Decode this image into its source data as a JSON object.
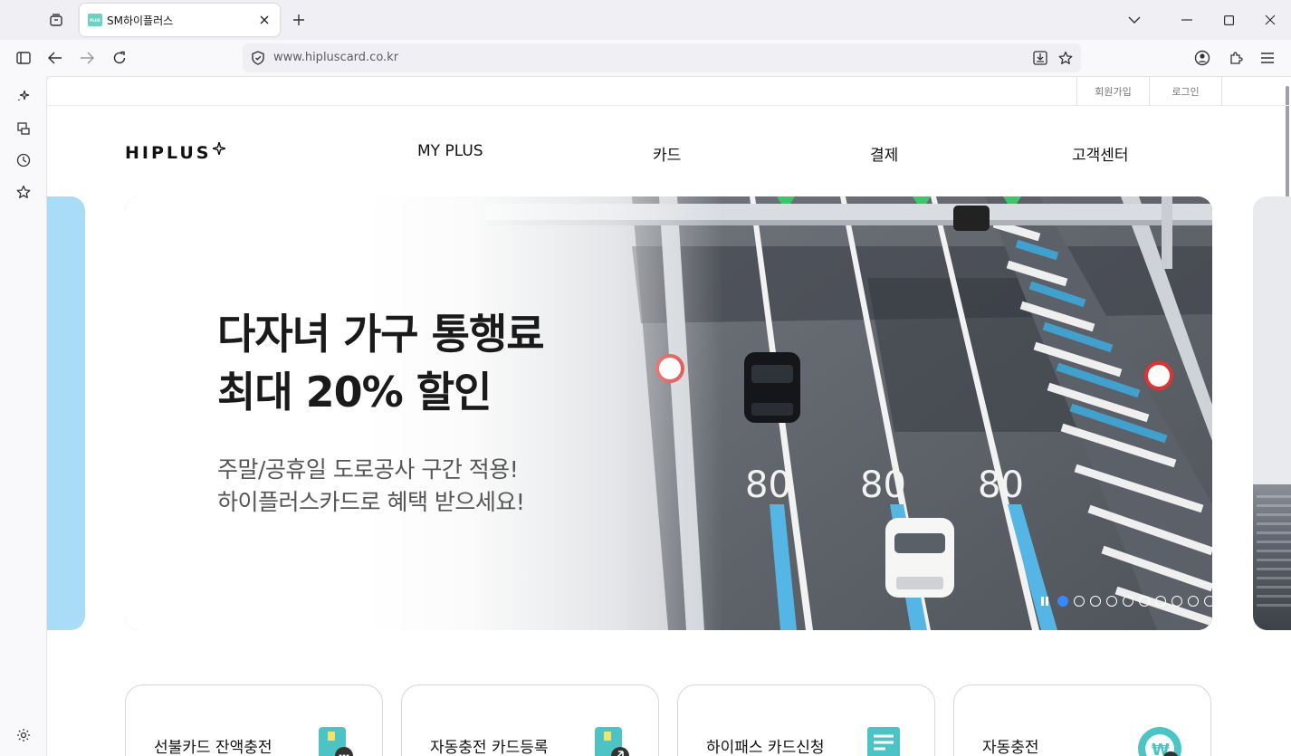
{
  "browser": {
    "tab_title": "SM하이플러스",
    "favicon_text": "PLUS",
    "url": "www.hipluscard.co.kr"
  },
  "page": {
    "util_links": [
      "회원가입",
      "로그인"
    ],
    "logo": "HIPLUS",
    "gnb": [
      "MY PLUS",
      "카드",
      "결제",
      "고객센터"
    ],
    "hero": {
      "title_line1": "다자녀 가구 통행료",
      "title_line2": "최대 20% 할인",
      "sub_line1": "주말/공휴일 도로공사 구간 적용!",
      "sub_line2": "하이플러스카드로 혜택 받으세요!",
      "road_speed_marks": [
        "80",
        "80",
        "80"
      ],
      "slide_count": 11,
      "active_slide": 1
    },
    "quick_menu": [
      "선불카드 잔액충전",
      "자동충전 카드등록",
      "하이패스 카드신청",
      "자동충전"
    ]
  },
  "colors": {
    "accent_blue": "#3a86ff",
    "teal": "#4cc4c6",
    "prev_slide": "#a9dcf7"
  },
  "icons": {
    "tab_list": "tab-list-icon",
    "close": "close-icon",
    "new_tab": "plus-icon",
    "back": "back-arrow-icon",
    "forward": "forward-arrow-icon",
    "reload": "reload-icon",
    "shield": "shield-icon",
    "download": "download-icon",
    "bookmark": "star-icon",
    "account": "account-icon",
    "extensions": "puzzle-icon",
    "menu": "hamburger-icon"
  }
}
